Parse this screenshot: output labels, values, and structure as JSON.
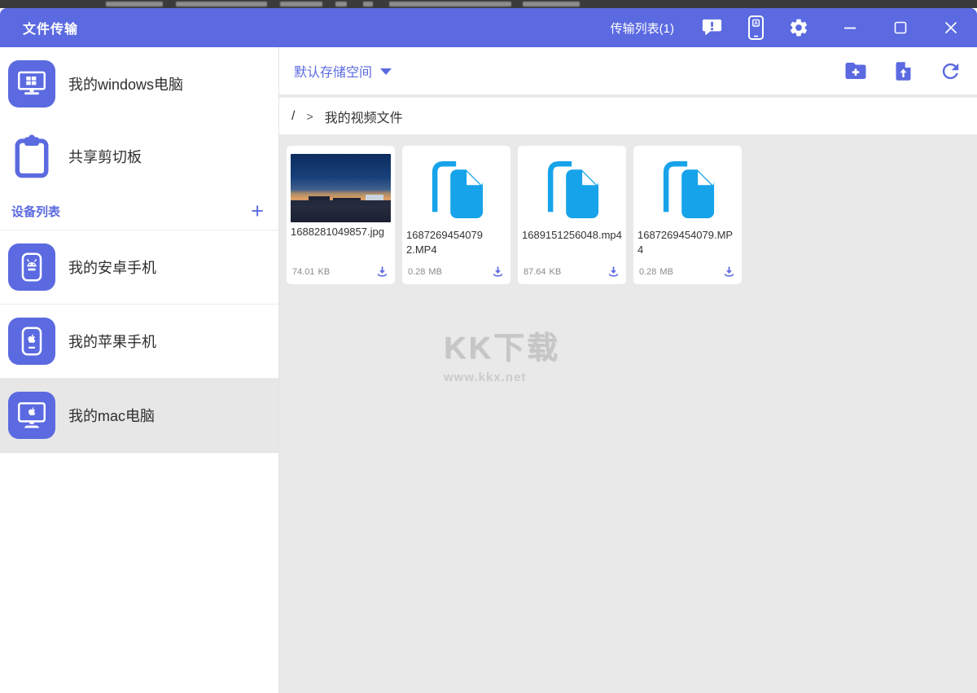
{
  "window": {
    "title": "文件传输",
    "transfer_list_label": "传输列表(1)"
  },
  "sidebar": {
    "items": [
      {
        "label": "我的windows电脑"
      },
      {
        "label": "共享剪切板"
      }
    ],
    "device_section": {
      "title": "设备列表",
      "add_label": "+"
    },
    "devices": [
      {
        "label": "我的安卓手机",
        "selected": false
      },
      {
        "label": "我的苹果手机",
        "selected": false
      },
      {
        "label": "我的mac电脑",
        "selected": true
      }
    ]
  },
  "toolbar": {
    "storage_selector": "默认存储空间"
  },
  "breadcrumb": {
    "root": "/",
    "separator": ">",
    "current": "我的视频文件"
  },
  "files": [
    {
      "name": "1688281049857.jpg",
      "size_value": "74.01",
      "size_unit": "KB",
      "kind": "image"
    },
    {
      "name": "1687269454079 2.MP4",
      "size_value": "0.28",
      "size_unit": "MB",
      "kind": "video"
    },
    {
      "name": "1689151256048.mp4",
      "size_value": "87.64",
      "size_unit": "KB",
      "kind": "video"
    },
    {
      "name": "1687269454079.MP4",
      "size_value": "0.28",
      "size_unit": "MB",
      "kind": "video"
    }
  ],
  "watermark": {
    "logo": "KK下载",
    "site": "www.kkx.net"
  },
  "colors": {
    "accent": "#5b6ae0",
    "doc": "#17a3ea",
    "main_bg": "#e9e9e9",
    "selected_bg": "#e7e7e7",
    "strip": "#3a3a3a",
    "title_text": "#ffffff"
  }
}
